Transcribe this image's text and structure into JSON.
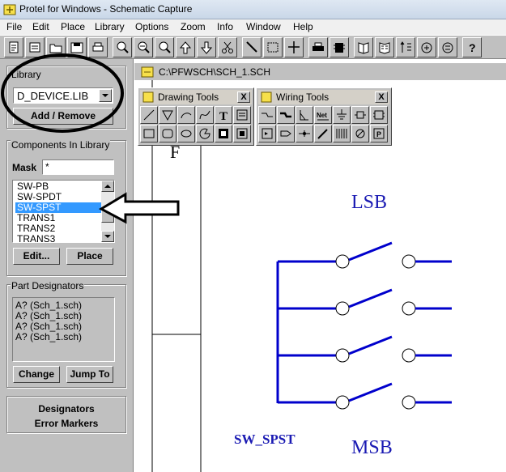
{
  "window": {
    "title": "Protel for Windows - Schematic Capture"
  },
  "menu": [
    "File",
    "Edit",
    "Place",
    "Library",
    "Options",
    "Zoom",
    "Info",
    "Window",
    "Help"
  ],
  "toolbar": {
    "buttons": [
      "new-icon",
      "open-icon",
      "open-folder-icon",
      "save-icon",
      "print-icon",
      "zoom-in-icon",
      "zoom-out-icon",
      "zoom-fit-icon",
      "pan-up-icon",
      "pan-down-icon",
      "cut-icon",
      "wire-icon",
      "select-area-icon",
      "move-cross-icon",
      "printer-icon",
      "place-part-icon",
      "library-book-icon",
      "library-browse-icon",
      "sort-icon",
      "hierarchy-icon",
      "net-icon",
      "help-icon"
    ]
  },
  "library": {
    "group_label": "Library",
    "selected": "D_DEVICE.LIB",
    "add_remove": "Add / Remove"
  },
  "components": {
    "group_label": "Components In Library",
    "mask_label": "Mask",
    "mask_value": "*",
    "items": [
      "SW-PB",
      "SW-SPDT",
      "SW-SPST",
      "TRANS1",
      "TRANS2",
      "TRANS3"
    ],
    "selected_index": 2,
    "edit_label": "Edit...",
    "place_label": "Place"
  },
  "part_designators": {
    "group_label": "Part Designators",
    "items": [
      "A? (Sch_1.sch)",
      "A? (Sch_1.sch)",
      "A? (Sch_1.sch)",
      "A? (Sch_1.sch)"
    ],
    "change_label": "Change",
    "jump_label": "Jump To"
  },
  "bottom_group": {
    "designators": "Designators",
    "error_markers": "Error Markers"
  },
  "document": {
    "title": "C:\\PFWSCH\\SCH_1.SCH",
    "border_letter": "F"
  },
  "drawing_tools": {
    "title": "Drawing Tools",
    "close": "X"
  },
  "wiring_tools": {
    "title": "Wiring Tools",
    "close": "X",
    "net_label": "Net"
  },
  "schematic": {
    "lsb": "LSB",
    "msb": "MSB",
    "part_name": "SW_SPST",
    "switch_count": 4
  },
  "colors": {
    "wire": "#0000cc",
    "part_text": "#1a1ab3",
    "selection": "#3399ff",
    "panel": "#c0c0c0"
  }
}
